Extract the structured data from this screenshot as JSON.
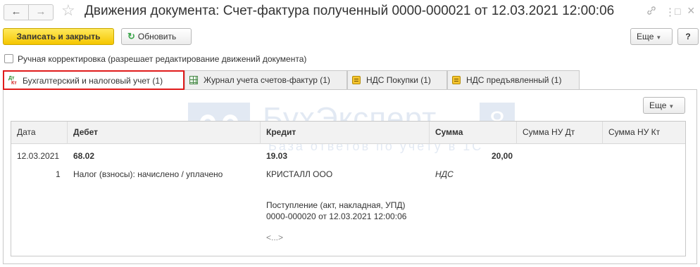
{
  "window": {
    "title": "Движения документа: Счет-фактура полученный 0000-000021 от 12.03.2021 12:00:06",
    "nav_back": "←",
    "nav_forward": "→",
    "star": "☆",
    "link_icon": "🔗",
    "menu_icon": "⋮",
    "maximize_icon": "□",
    "close_icon": "×"
  },
  "toolbar": {
    "save_close_label": "Записать и закрыть",
    "refresh_label": "Обновить",
    "more_label": "Еще",
    "help_label": "?"
  },
  "manual_correction_label": "Ручная корректировка (разрешает редактирование движений документа)",
  "tabs": [
    {
      "label": "Бухгалтерский и налоговый учет (1)",
      "icon": "dt-kt-icon"
    },
    {
      "label": "Журнал учета счетов-фактур (1)",
      "icon": "grid-icon"
    },
    {
      "label": "НДС Покупки (1)",
      "icon": "register-icon"
    },
    {
      "label": "НДС предъявленный (1)",
      "icon": "register-icon"
    }
  ],
  "tab_icon_text": {
    "dt": "Дт",
    "kt": "Кт"
  },
  "panel": {
    "more_label": "Еще"
  },
  "watermark": {
    "brand": "БухЭксперт",
    "digit": "8",
    "tagline": "База ответов по учёту в 1С"
  },
  "table": {
    "columns": [
      "Дата",
      "Дебет",
      "Кредит",
      "Сумма",
      "Сумма НУ Дт",
      "Сумма НУ Кт"
    ],
    "row": {
      "date": "12.03.2021",
      "number": "1",
      "debit_account": "68.02",
      "debit_subconto": "Налог (взносы): начислено / уплачено",
      "credit_account": "19.03",
      "credit_subconto1": "КРИСТАЛЛ ООО",
      "credit_subconto2": "Поступление (акт, накладная, УПД)",
      "credit_subconto2_doc": "0000-000020 от 12.03.2021 12:00:06",
      "credit_subconto3": "<...>",
      "amount": "20,00",
      "amount_content": "НДС"
    }
  }
}
